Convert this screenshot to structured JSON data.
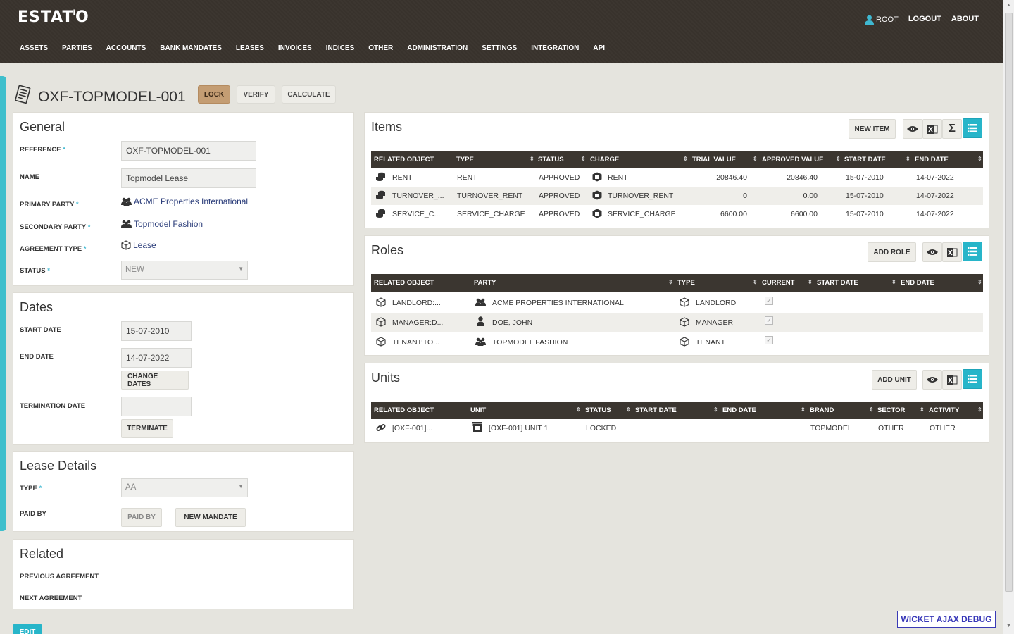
{
  "app": {
    "logo_prefix": "ESTAT",
    "logo_i": "i",
    "logo_suffix": "O",
    "user": "ROOT",
    "logout": "LOGOUT",
    "about": "ABOUT"
  },
  "nav": [
    "ASSETS",
    "PARTIES",
    "ACCOUNTS",
    "BANK MANDATES",
    "LEASES",
    "INVOICES",
    "INDICES",
    "OTHER",
    "ADMINISTRATION",
    "SETTINGS",
    "INTEGRATION",
    "API"
  ],
  "title": "OXF-TOPMODEL-001",
  "actions": {
    "lock": "LOCK",
    "verify": "VERIFY",
    "calculate": "CALCULATE"
  },
  "general": {
    "heading": "General",
    "reference_label": "REFERENCE",
    "reference_value": "OXF-TOPMODEL-001",
    "name_label": "NAME",
    "name_value": "Topmodel Lease",
    "primary_party_label": "PRIMARY PARTY",
    "primary_party_value": "ACME Properties International",
    "secondary_party_label": "SECONDARY PARTY",
    "secondary_party_value": "Topmodel Fashion",
    "agreement_type_label": "AGREEMENT TYPE",
    "agreement_type_value": "Lease",
    "status_label": "STATUS",
    "status_value": "NEW",
    "required_mark": "*"
  },
  "dates": {
    "heading": "Dates",
    "start_label": "START DATE",
    "start_value": "15-07-2010",
    "end_label": "END DATE",
    "end_value": "14-07-2022",
    "change_dates": "CHANGE DATES",
    "termination_label": "TERMINATION DATE",
    "termination_value": "",
    "terminate": "TERMINATE"
  },
  "lease_details": {
    "heading": "Lease Details",
    "type_label": "TYPE",
    "type_value": "AA",
    "paid_by_label": "PAID BY",
    "paid_by_button": "PAID BY",
    "new_mandate_button": "NEW MANDATE"
  },
  "related": {
    "heading": "Related",
    "previous": "PREVIOUS AGREEMENT",
    "next": "NEXT AGREEMENT"
  },
  "edit": "EDIT",
  "items": {
    "heading": "Items",
    "new_button": "NEW ITEM",
    "sum_symbol": "Σ",
    "columns": [
      "RELATED OBJECT",
      "TYPE",
      "STATUS",
      "CHARGE",
      "TRIAL VALUE",
      "APPROVED VALUE",
      "START DATE",
      "END DATE"
    ],
    "rows": [
      [
        "RENT",
        "RENT",
        "APPROVED",
        "RENT",
        "20846.40",
        "20846.40",
        "15-07-2010",
        "14-07-2022"
      ],
      [
        "TURNOVER_...",
        "TURNOVER_RENT",
        "APPROVED",
        "TURNOVER_RENT",
        "0",
        "0.00",
        "15-07-2010",
        "14-07-2022"
      ],
      [
        "SERVICE_C...",
        "SERVICE_CHARGE",
        "APPROVED",
        "SERVICE_CHARGE",
        "6600.00",
        "6600.00",
        "15-07-2010",
        "14-07-2022"
      ]
    ]
  },
  "roles": {
    "heading": "Roles",
    "add_button": "ADD ROLE",
    "columns": [
      "RELATED OBJECT",
      "PARTY",
      "TYPE",
      "CURRENT",
      "START DATE",
      "END DATE"
    ],
    "rows": [
      [
        "LANDLORD:...",
        "ACME PROPERTIES INTERNATIONAL",
        "LANDLORD"
      ],
      [
        "MANAGER:D...",
        "DOE, JOHN",
        "MANAGER"
      ],
      [
        "TENANT:TO...",
        "TOPMODEL FASHION",
        "TENANT"
      ]
    ]
  },
  "units": {
    "heading": "Units",
    "add_button": "ADD UNIT",
    "columns": [
      "RELATED OBJECT",
      "UNIT",
      "STATUS",
      "START DATE",
      "END DATE",
      "BRAND",
      "SECTOR",
      "ACTIVITY"
    ],
    "rows": [
      [
        "[OXF-001]...",
        "[OXF-001] UNIT 1",
        "LOCKED",
        "TOPMODEL",
        "OTHER",
        "OTHER"
      ]
    ]
  },
  "debug": "WICKET AJAX DEBUG",
  "colors": {
    "accent": "#27b5c9",
    "header_bg": "#39332d",
    "lock": "#c49d73",
    "link": "#2b3d7a"
  }
}
